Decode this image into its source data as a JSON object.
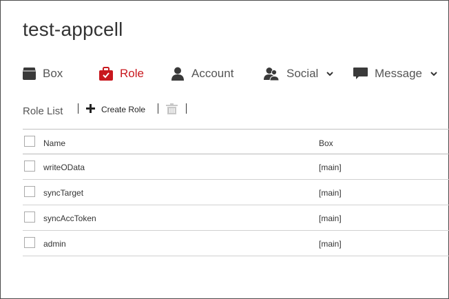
{
  "app": {
    "title": "test-appcell"
  },
  "nav": {
    "items": [
      {
        "label": "Box",
        "icon": "box-icon",
        "active": false
      },
      {
        "label": "Role",
        "icon": "role-icon",
        "active": true
      },
      {
        "label": "Account",
        "icon": "account-icon",
        "active": false
      },
      {
        "label": "Social",
        "icon": "social-icon",
        "active": false,
        "dropdown": true
      },
      {
        "label": "Message",
        "icon": "message-icon",
        "active": false,
        "dropdown": true
      }
    ]
  },
  "toolbar": {
    "list_label": "Role List",
    "create_label": "Create Role"
  },
  "table": {
    "headers": {
      "name": "Name",
      "box": "Box"
    },
    "rows": [
      {
        "name": "writeOData",
        "box": "[main]"
      },
      {
        "name": "syncTarget",
        "box": "[main]"
      },
      {
        "name": "syncAccToken",
        "box": "[main]"
      },
      {
        "name": "admin",
        "box": "[main]"
      }
    ]
  },
  "colors": {
    "accent": "#c8181e",
    "text": "#333333",
    "muted": "#555555",
    "disabled": "#c8c8c8"
  }
}
